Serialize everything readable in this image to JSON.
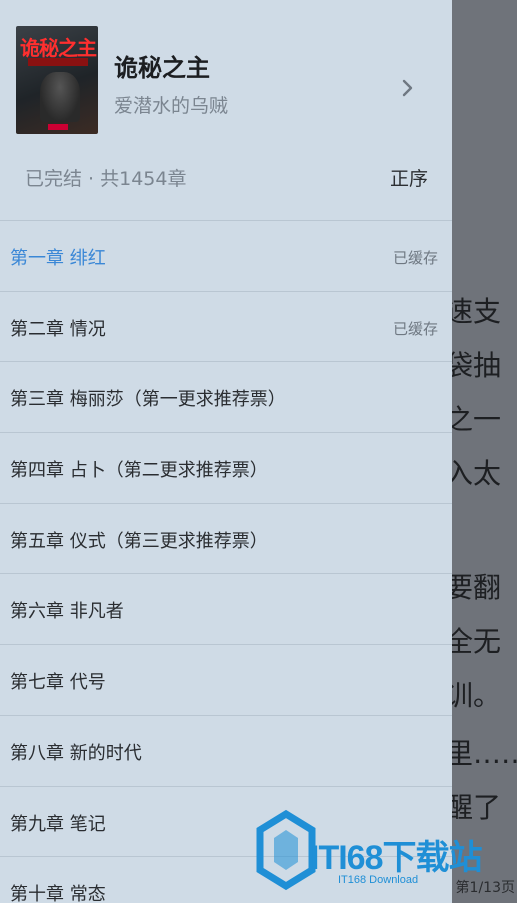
{
  "reader": {
    "lines": [
      "速支",
      "袋抽",
      "之一",
      "入太",
      "要翻",
      "全无",
      "训。",
      "里……",
      "醒了"
    ],
    "page_indicator": "第1/13页"
  },
  "book": {
    "cover_title": "诡秘之主",
    "title": "诡秘之主",
    "author": "爱潜水的乌贼"
  },
  "toc": {
    "status": "已完结 · 共1454章",
    "sort_label": "正序",
    "chapters": [
      {
        "title": "第一章 绯红",
        "badge": "已缓存"
      },
      {
        "title": "第二章 情况",
        "badge": "已缓存"
      },
      {
        "title": "第三章 梅丽莎（第一更求推荐票）",
        "badge": ""
      },
      {
        "title": "第四章 占卜（第二更求推荐票）",
        "badge": ""
      },
      {
        "title": "第五章 仪式（第三更求推荐票）",
        "badge": ""
      },
      {
        "title": "第六章 非凡者",
        "badge": ""
      },
      {
        "title": "第七章 代号",
        "badge": ""
      },
      {
        "title": "第八章 新的时代",
        "badge": ""
      },
      {
        "title": "第九章 笔记",
        "badge": ""
      },
      {
        "title": "第十章 常态",
        "badge": ""
      }
    ]
  },
  "watermark": {
    "main": "ITI68下载站",
    "sub": "IT168 Download"
  },
  "colors": {
    "active_chapter": "#3a87d6",
    "drawer_bg": "#cfdbe6",
    "watermark": "#1f8fd6"
  }
}
